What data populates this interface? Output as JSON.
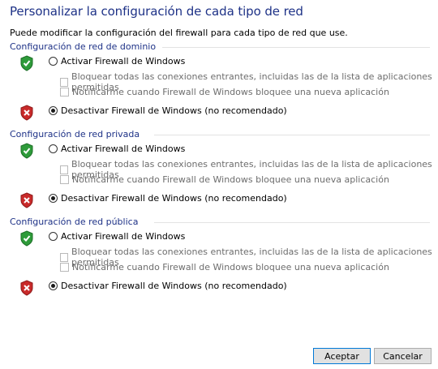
{
  "page": {
    "title": "Personalizar la configuración de cada tipo de red",
    "subtitle": "Puede modificar la configuración del firewall para cada tipo de red que use."
  },
  "sections": [
    {
      "heading": "Configuración de red de dominio",
      "on_label": "Activar Firewall de Windows",
      "block_label": "Bloquear todas las conexiones entrantes, incluidas las de la lista de aplicaciones permitidas",
      "notify_label": "Notificarme cuando Firewall de Windows bloquee una nueva aplicación",
      "off_label": "Desactivar Firewall de Windows (no recomendado)",
      "selected": "off"
    },
    {
      "heading": "Configuración de red privada",
      "on_label": "Activar Firewall de Windows",
      "block_label": "Bloquear todas las conexiones entrantes, incluidas las de la lista de aplicaciones permitidas",
      "notify_label": "Notificarme cuando Firewall de Windows bloquee una nueva aplicación",
      "off_label": "Desactivar Firewall de Windows (no recomendado)",
      "selected": "off"
    },
    {
      "heading": "Configuración de red pública",
      "on_label": "Activar Firewall de Windows",
      "block_label": "Bloquear todas las conexiones entrantes, incluidas las de la lista de aplicaciones permitidas",
      "notify_label": "Notificarme cuando Firewall de Windows bloquee una nueva aplicación",
      "off_label": "Desactivar Firewall de Windows (no recomendado)",
      "selected": "off"
    }
  ],
  "buttons": {
    "ok": "Aceptar",
    "cancel": "Cancelar"
  },
  "colors": {
    "heading": "#1e3287",
    "shield_green": "#2e9b3a",
    "shield_red": "#c92a2a"
  },
  "icons": {
    "on": "shield-check-icon",
    "off": "shield-x-icon"
  }
}
